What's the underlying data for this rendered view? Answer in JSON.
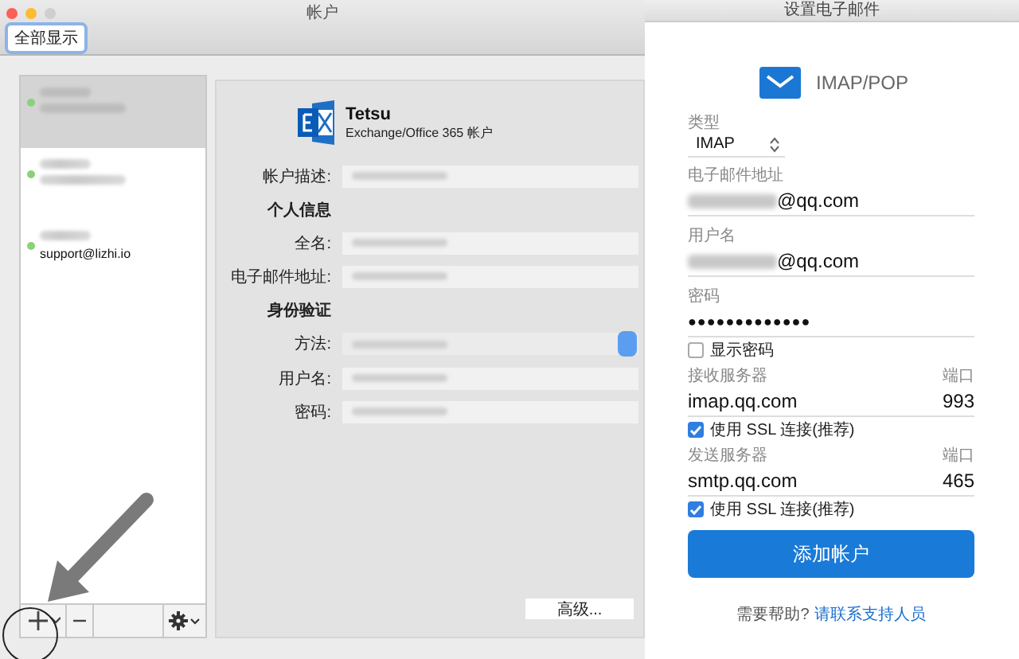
{
  "window": {
    "title": "帐户",
    "show_all_button": "全部显示"
  },
  "accounts": [
    {
      "selected": true
    },
    {
      "selected": false
    },
    {
      "selected": false,
      "email": "support@lizhi.io"
    }
  ],
  "detail": {
    "name": "Tetsu",
    "account_type": "Exchange/Office 365 帐户",
    "rows": [
      {
        "kind": "field",
        "label": "帐户描述:"
      },
      {
        "kind": "heading",
        "label": "个人信息"
      },
      {
        "kind": "field",
        "label": "全名:"
      },
      {
        "kind": "field",
        "label": "电子邮件地址:"
      },
      {
        "kind": "heading",
        "label": "身份验证"
      },
      {
        "kind": "popup",
        "label": "方法:"
      },
      {
        "kind": "field",
        "label": "用户名:"
      },
      {
        "kind": "field",
        "label": "密码:"
      }
    ],
    "advanced_button": "高级..."
  },
  "dialog": {
    "title": "设置电子邮件",
    "account_type": "IMAP/POP",
    "fields": [
      {
        "kind": "select",
        "label": "类型",
        "value": "IMAP"
      },
      {
        "kind": "text",
        "label": "电子邮件地址",
        "value": "@qq.com",
        "masked_prefix": true
      },
      {
        "kind": "text",
        "label": "用户名",
        "value": "@qq.com",
        "masked_prefix": true
      },
      {
        "kind": "password",
        "label": "密码",
        "value": "●●●●●●●●●●●●●"
      },
      {
        "kind": "checkbox",
        "label": "显示密码",
        "checked": false
      },
      {
        "kind": "server",
        "label": "接收服务器",
        "port_label": "端口",
        "value": "imap.qq.com",
        "port": "993"
      },
      {
        "kind": "checkbox",
        "label": "使用 SSL 连接(推荐)",
        "checked": true
      },
      {
        "kind": "server",
        "label": "发送服务器",
        "port_label": "端口",
        "value": "smtp.qq.com",
        "port": "465"
      },
      {
        "kind": "checkbox",
        "label": "使用 SSL 连接(推荐)",
        "checked": true
      }
    ],
    "add_button": "添加帐户",
    "help": {
      "text": "需要帮助?",
      "link": "请联系支持人员"
    }
  }
}
